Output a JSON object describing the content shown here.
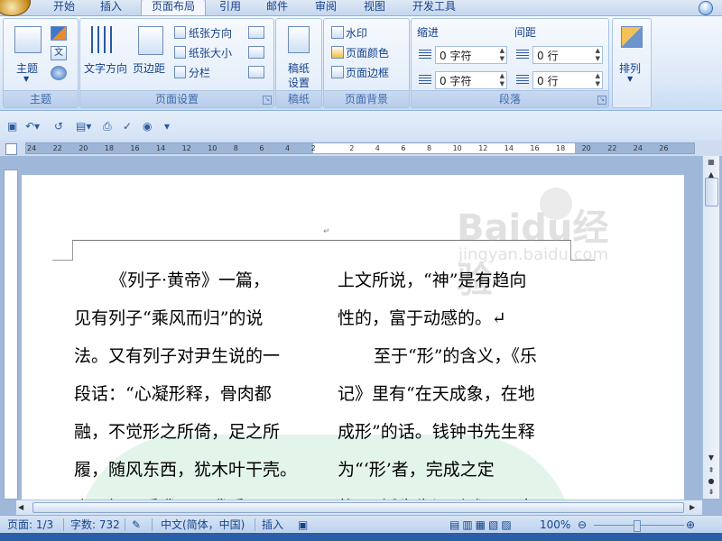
{
  "tabs": [
    "开始",
    "插入",
    "页面布局",
    "引用",
    "邮件",
    "审阅",
    "视图",
    "开发工具"
  ],
  "active_tab": "页面布局",
  "help_icon": "?",
  "ribbon": {
    "theme_group": {
      "label": "主题",
      "button": "主题"
    },
    "page_setup_group": {
      "label": "页面设置",
      "text_direction": "文字方向",
      "margins": "页边距",
      "orientation": "纸张方向",
      "size": "纸张大小",
      "columns": "分栏"
    },
    "manuscript_group": {
      "label": "稿纸",
      "button_line1": "稿纸",
      "button_line2": "设置"
    },
    "page_background_group": {
      "label": "页面背景",
      "watermark": "水印",
      "page_color": "页面颜色",
      "page_borders": "页面边框"
    },
    "paragraph_group": {
      "label": "段落",
      "indent_label": "缩进",
      "spacing_label": "间距",
      "indent_left": "0 字符",
      "indent_right": "0 字符",
      "spacing_before": "0 行",
      "spacing_after": "0 行"
    },
    "arrange_group": {
      "button": "排列"
    }
  },
  "ruler_numbers": [
    "24",
    "22",
    "20",
    "18",
    "16",
    "14",
    "12",
    "10",
    "8",
    "6",
    "4",
    "2",
    "2",
    "4",
    "6",
    "8",
    "10",
    "12",
    "14",
    "16",
    "18",
    "20",
    "22",
    "24",
    "26"
  ],
  "document": {
    "header_mark": "↵",
    "left_column": [
      "《列子·黄帝》一篇，",
      "见有列子“乘风而归”的说",
      "法。又有列子对尹生说的一",
      "段话：“心凝形释，骨肉都",
      "融，不觉形之所倚，足之所",
      "履，随风东西，犹木叶干壳。",
      "竟不知风乘我邪？我乘风"
    ],
    "right_column": [
      "上文所说，“神”是有趋向",
      "性的，富于动感的。↵",
      "至于“形”的含义，《乐",
      "记》里有“在天成象，在地",
      "成形”的话。钱钟书先生释",
      "为“‘形’者，完成之定",
      "状”，锺先生还引述了马克"
    ]
  },
  "watermark": {
    "brand": "Bai",
    "brand2": "du",
    "tail": "经验",
    "url": "jingyan.baidu.com"
  },
  "status": {
    "page": "页面: 1/3",
    "words": "字数: 732",
    "language": "中文(简体，中国)",
    "mode": "插入",
    "zoom": "100%"
  },
  "colors": {
    "ribbon_text": "#15428b",
    "accent": "#2a5fa8"
  }
}
